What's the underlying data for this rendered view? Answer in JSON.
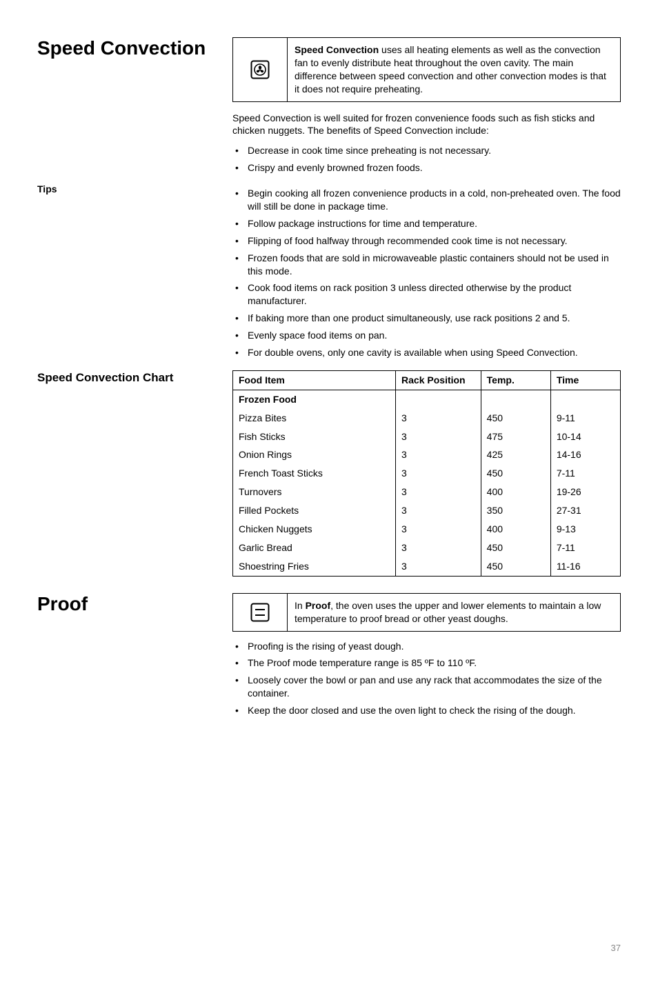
{
  "section1": {
    "title": "Speed Convection",
    "box_bold": "Speed Convection",
    "box_text": " uses all heating elements as well as the convection fan to evenly distribute heat throughout the oven cavity. The main difference between speed convection and other convection modes is that it does not require preheating.",
    "intro_para": "Speed Convection is well suited for frozen convenience foods such as fish sticks and chicken nuggets. The benefits of Speed Convection include:",
    "benefits": [
      "Decrease in cook time since preheating is not necessary.",
      "Crispy and evenly browned frozen foods."
    ],
    "tips_label": "Tips",
    "tips": [
      "Begin cooking all frozen convenience products in a cold, non-preheated oven. The food will still be done in package time.",
      "Follow package instructions for time and temperature.",
      "Flipping of food halfway through recommended cook time is not necessary.",
      "Frozen foods that are sold in microwaveable plastic containers should not be used in this mode.",
      "Cook food items on rack position 3 unless directed otherwise by the product manufacturer.",
      "If baking more than one product simultaneously, use rack positions 2 and 5.",
      "Evenly space food items on pan.",
      "For double ovens, only one cavity is available when using Speed Convection."
    ],
    "chart_label": "Speed Convection Chart",
    "chart_headers": [
      "Food Item",
      "Rack Position",
      "Temp.",
      "Time"
    ],
    "chart_category": "Frozen Food",
    "chart_rows": [
      {
        "item": "Pizza Bites",
        "rack": "3",
        "temp": "450",
        "time": "9-11"
      },
      {
        "item": "Fish Sticks",
        "rack": "3",
        "temp": "475",
        "time": "10-14"
      },
      {
        "item": "Onion Rings",
        "rack": "3",
        "temp": "425",
        "time": "14-16"
      },
      {
        "item": "French Toast Sticks",
        "rack": "3",
        "temp": "450",
        "time": "7-11"
      },
      {
        "item": "Turnovers",
        "rack": "3",
        "temp": "400",
        "time": "19-26"
      },
      {
        "item": "Filled Pockets",
        "rack": "3",
        "temp": "350",
        "time": "27-31"
      },
      {
        "item": "Chicken Nuggets",
        "rack": "3",
        "temp": "400",
        "time": "9-13"
      },
      {
        "item": "Garlic Bread",
        "rack": "3",
        "temp": "450",
        "time": "7-11"
      },
      {
        "item": "Shoestring Fries",
        "rack": "3",
        "temp": "450",
        "time": "11-16"
      }
    ]
  },
  "section2": {
    "title": "Proof",
    "box_pre": "In ",
    "box_bold": "Proof",
    "box_text": ", the oven uses the upper and lower elements to maintain a low temperature to proof bread or other yeast doughs.",
    "bullets": [
      "Proofing is the rising of yeast dough.",
      "The Proof mode temperature range is 85 ºF to 110 ºF.",
      "Loosely cover the bowl or pan and use any rack that accommodates the size of the container.",
      "Keep the door closed and use the oven light to check the rising of the dough."
    ]
  },
  "page_number": "37",
  "chart_data": {
    "type": "table",
    "title": "Speed Convection Chart",
    "columns": [
      "Food Item",
      "Rack Position",
      "Temp.",
      "Time"
    ],
    "category": "Frozen Food",
    "rows": [
      [
        "Pizza Bites",
        "3",
        "450",
        "9-11"
      ],
      [
        "Fish Sticks",
        "3",
        "475",
        "10-14"
      ],
      [
        "Onion Rings",
        "3",
        "425",
        "14-16"
      ],
      [
        "French Toast Sticks",
        "3",
        "450",
        "7-11"
      ],
      [
        "Turnovers",
        "3",
        "400",
        "19-26"
      ],
      [
        "Filled Pockets",
        "3",
        "350",
        "27-31"
      ],
      [
        "Chicken Nuggets",
        "3",
        "400",
        "9-13"
      ],
      [
        "Garlic Bread",
        "3",
        "450",
        "7-11"
      ],
      [
        "Shoestring Fries",
        "3",
        "450",
        "11-16"
      ]
    ]
  }
}
